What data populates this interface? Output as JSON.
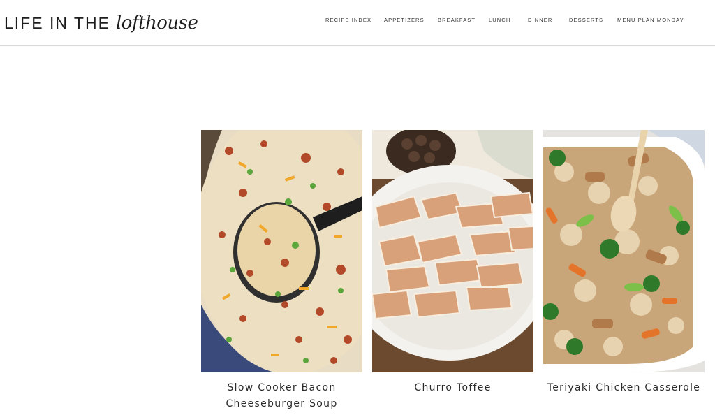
{
  "site": {
    "logo_main": "LIFE IN THE",
    "logo_script": "lofthouse"
  },
  "nav": {
    "items": [
      "RECIPE INDEX",
      "APPETIZERS",
      "BREAKFAST",
      "LUNCH",
      "DINNER",
      "DESSERTS",
      "MENU PLAN MONDAY"
    ]
  },
  "recipes": [
    {
      "title": "Slow Cooker Bacon Cheeseburger Soup",
      "image": "cheeseburger-soup-photo"
    },
    {
      "title": "Churro Toffee",
      "image": "churro-toffee-photo"
    },
    {
      "title": "Teriyaki Chicken Casserole",
      "image": "teriyaki-casserole-photo"
    }
  ],
  "colors": {
    "text": "#222222",
    "divider": "#d8d8d8"
  }
}
